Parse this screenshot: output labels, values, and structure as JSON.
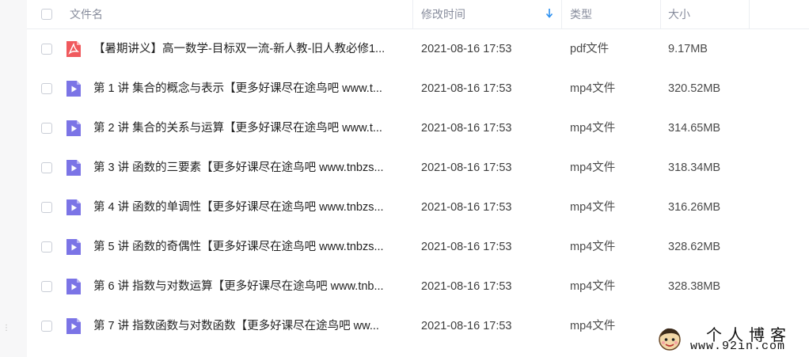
{
  "header": {
    "name_label": "文件名",
    "time_label": "修改时间",
    "type_label": "类型",
    "size_label": "大小",
    "sort_icon": "sort-descending-arrow-icon",
    "accent_color": "#2b8ff0"
  },
  "files": [
    {
      "icon": "pdf-icon",
      "name": "【暑期讲义】高一数学-目标双一流-新人教-旧人教必修1...",
      "time": "2021-08-16 17:53",
      "type": "pdf文件",
      "size": "9.17MB"
    },
    {
      "icon": "video-icon",
      "name": "第 1 讲 集合的概念与表示【更多好课尽在途鸟吧 www.t...",
      "time": "2021-08-16 17:53",
      "type": "mp4文件",
      "size": "320.52MB"
    },
    {
      "icon": "video-icon",
      "name": "第 2 讲 集合的关系与运算【更多好课尽在途鸟吧 www.t...",
      "time": "2021-08-16 17:53",
      "type": "mp4文件",
      "size": "314.65MB"
    },
    {
      "icon": "video-icon",
      "name": "第 3 讲 函数的三要素【更多好课尽在途鸟吧 www.tnbzs...",
      "time": "2021-08-16 17:53",
      "type": "mp4文件",
      "size": "318.34MB"
    },
    {
      "icon": "video-icon",
      "name": "第 4 讲 函数的单调性【更多好课尽在途鸟吧 www.tnbzs...",
      "time": "2021-08-16 17:53",
      "type": "mp4文件",
      "size": "316.26MB"
    },
    {
      "icon": "video-icon",
      "name": "第 5 讲 函数的奇偶性【更多好课尽在途鸟吧 www.tnbzs...",
      "time": "2021-08-16 17:53",
      "type": "mp4文件",
      "size": "328.62MB"
    },
    {
      "icon": "video-icon",
      "name": "第 6 讲 指数与对数运算【更多好课尽在途鸟吧 www.tnb...",
      "time": "2021-08-16 17:53",
      "type": "mp4文件",
      "size": "328.38MB"
    },
    {
      "icon": "video-icon",
      "name": "第 7 讲 指数函数与对数函数【更多好课尽在途鸟吧 ww...",
      "time": "2021-08-16 17:53",
      "type": "mp4文件",
      "size": ""
    }
  ],
  "colors": {
    "pdf_icon": "#f0595d",
    "video_icon": "#7b74e6"
  },
  "watermark": {
    "title": "个人博客",
    "url": "www.92in.com"
  }
}
